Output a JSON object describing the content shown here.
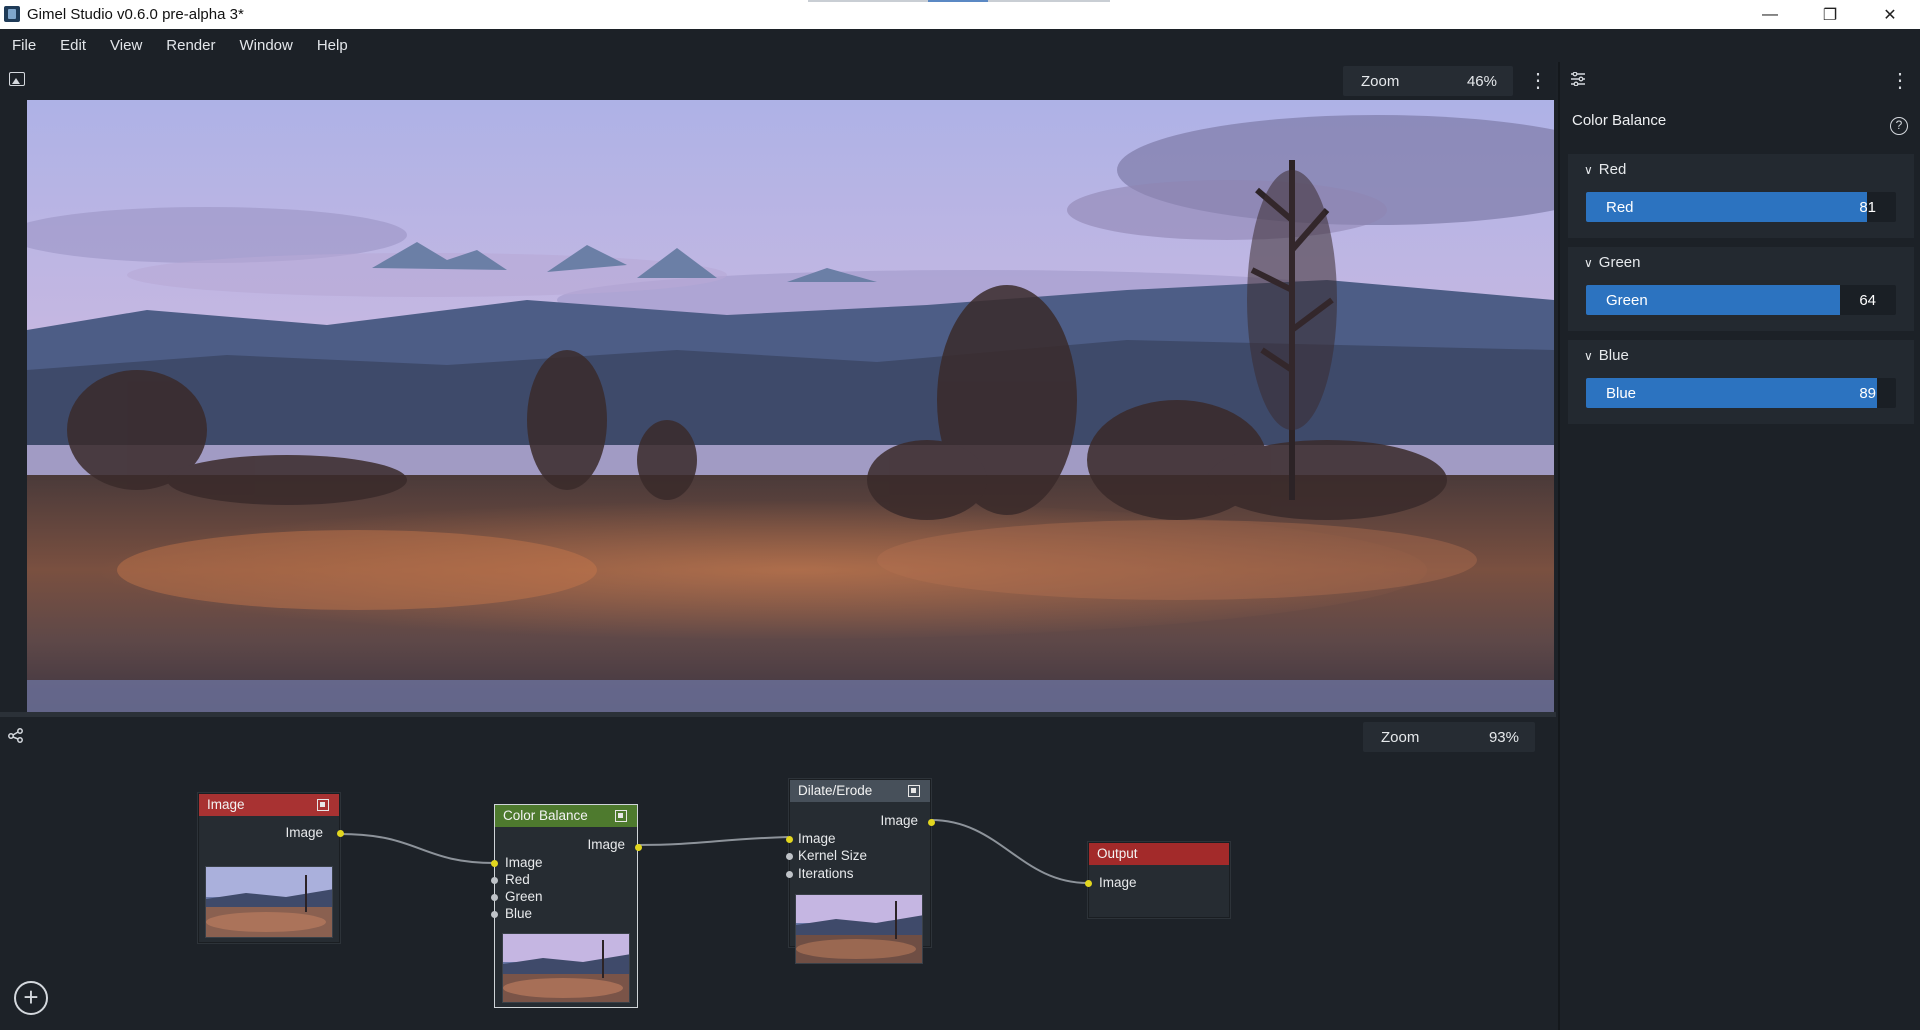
{
  "window": {
    "title": "Gimel Studio v0.6.0 pre-alpha 3*",
    "minimize_glyph": "—",
    "maximize_glyph": "❐",
    "close_glyph": "✕"
  },
  "menu": {
    "items": [
      {
        "label": "File"
      },
      {
        "label": "Edit"
      },
      {
        "label": "View"
      },
      {
        "label": "Render"
      },
      {
        "label": "Window"
      },
      {
        "label": "Help"
      }
    ]
  },
  "viewport": {
    "icon": "image-icon",
    "zoom_label": "Zoom",
    "zoom_value": "46%",
    "more_glyph": "⋮"
  },
  "node_editor": {
    "icon": "node-graph-icon",
    "zoom_label": "Zoom",
    "zoom_value": "93%",
    "add_glyph": "+",
    "nodes": {
      "image": {
        "title": "Image",
        "header_color": "#a83232",
        "output": "Image"
      },
      "color_balance": {
        "title": "Color Balance",
        "header_color": "#4e7a2e",
        "output": "Image",
        "inputs": [
          "Image",
          "Red",
          "Green",
          "Blue"
        ]
      },
      "dilate_erode": {
        "title": "Dilate/Erode",
        "header_color": "#47505a",
        "output": "Image",
        "inputs": [
          "Image",
          "Kernel Size",
          "Iterations"
        ]
      },
      "output": {
        "title": "Output",
        "header_color": "#a32a2a",
        "input": "Image"
      }
    }
  },
  "properties": {
    "icon": "sliders-icon",
    "more_glyph": "⋮",
    "title": "Color Balance",
    "help_glyph": "?",
    "sections": [
      {
        "heading": "Red",
        "slider_label": "Red",
        "value": "81",
        "fraction": 0.907
      },
      {
        "heading": "Green",
        "slider_label": "Green",
        "value": "64",
        "fraction": 0.82
      },
      {
        "heading": "Blue",
        "slider_label": "Blue",
        "value": "89",
        "fraction": 0.94
      }
    ],
    "accent_color": "#2c73c0"
  }
}
